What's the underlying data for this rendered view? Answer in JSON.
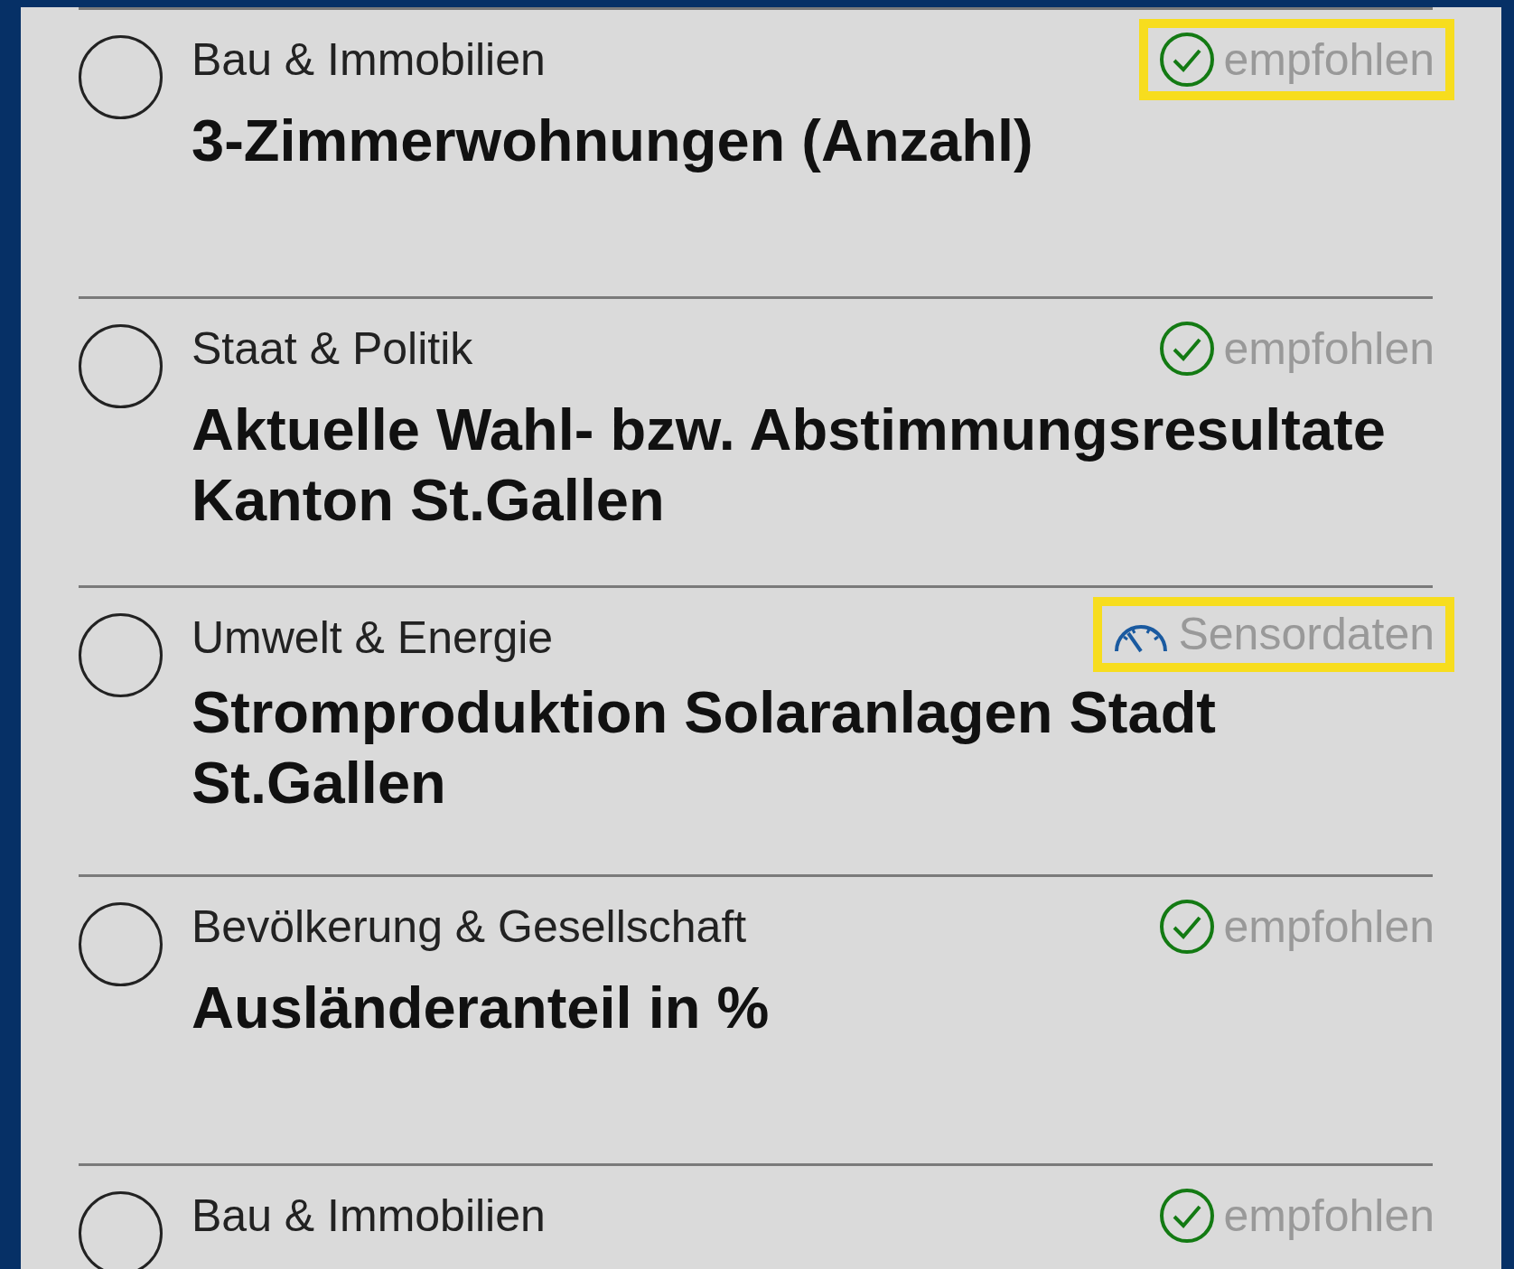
{
  "items": [
    {
      "category": "Bau & Immobilien",
      "title": "3-Zimmerwohnungen (Anzahl)",
      "selected": false,
      "badge": {
        "kind": "recommended",
        "label": "empfohlen"
      },
      "highlighted": true
    },
    {
      "category": "Staat & Politik",
      "title": "Aktuelle Wahl- bzw. Abstimmungsresultate Kanton St.Gallen",
      "selected": false,
      "badge": {
        "kind": "recommended",
        "label": "empfohlen"
      },
      "highlighted": false
    },
    {
      "category": "Umwelt & Energie",
      "title": "Stromproduktion Solaranlagen Stadt St.Gallen",
      "selected": false,
      "badge": {
        "kind": "sensor",
        "label": "Sensordaten"
      },
      "highlighted": true
    },
    {
      "category": "Bevölkerung & Gesellschaft",
      "title": "Ausländeranteil in %",
      "selected": false,
      "badge": {
        "kind": "recommended",
        "label": "empfohlen"
      },
      "highlighted": false
    },
    {
      "category": "Bau & Immobilien",
      "selected": false,
      "badge": {
        "kind": "recommended",
        "label": "empfohlen"
      },
      "highlighted": false
    }
  ]
}
